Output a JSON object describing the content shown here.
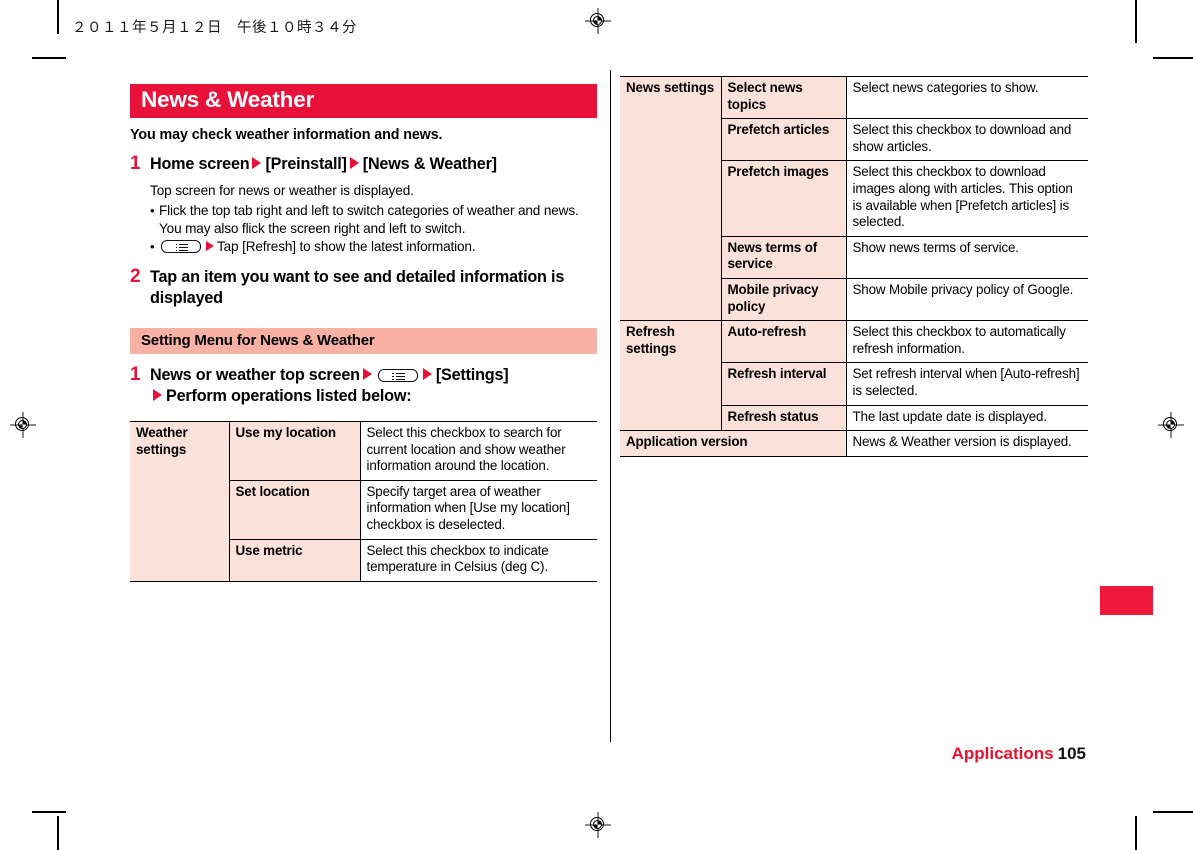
{
  "page": {
    "jp_date": "２０１１年５月１２日　午後１０時３４分",
    "footer_section": "Applications",
    "footer_page": "105",
    "accent_red": "#e8113a",
    "band_pink": "#f8b1a2",
    "cell_pink": "#fae2da"
  },
  "left": {
    "title": "News & Weather",
    "lead": "You may check weather information and news.",
    "step1": {
      "num": "1",
      "head_a": "Home screen",
      "head_b": "[Preinstall]",
      "head_c": "[News & Weather]",
      "para": "Top screen for news or weather is displayed.",
      "bullets": [
        {
          "dot": "•",
          "text": "Flick the top tab right and left to switch categories of weather and news. You may also flick the screen right and left to switch."
        }
      ],
      "bullet_key": {
        "dot": "•",
        "text": "Tap [Refresh] to show the latest information."
      }
    },
    "step2": {
      "num": "2",
      "head": "Tap an item you want to see and detailed information is displayed"
    },
    "sub_band": "Setting Menu for News & Weather",
    "step3": {
      "num": "1",
      "head_a": "News or weather top screen",
      "head_b": "[Settings]",
      "head_c": "Perform operations listed below:"
    },
    "table": {
      "groups": [
        {
          "name": "Weather settings",
          "rows": [
            {
              "key": "Use my location",
              "desc": "Select this checkbox to search for current location and show weather information around the location."
            },
            {
              "key": "Set location",
              "desc": "Specify target area of weather information when [Use my location] checkbox is deselected."
            },
            {
              "key": "Use metric",
              "desc": "Select this checkbox to indicate temperature in Celsius (deg C)."
            }
          ]
        }
      ]
    }
  },
  "right": {
    "table": {
      "groups": [
        {
          "name": "News settings",
          "rows": [
            {
              "key": "Select news topics",
              "desc": "Select news categories to show."
            },
            {
              "key": "Prefetch articles",
              "desc": "Select this checkbox to download and show articles."
            },
            {
              "key": "Prefetch images",
              "desc": "Select this checkbox to download images along with articles. This option is available when [Prefetch articles] is selected."
            },
            {
              "key": "News terms of service",
              "desc": "Show news terms of service."
            },
            {
              "key": "Mobile privacy policy",
              "desc": "Show Mobile privacy policy of Google."
            }
          ]
        },
        {
          "name": "Refresh settings",
          "rows": [
            {
              "key": "Auto-refresh",
              "desc": "Select this checkbox to automatically refresh information."
            },
            {
              "key": "Refresh interval",
              "desc": "Set refresh interval when [Auto-refresh] is selected."
            },
            {
              "key": "Refresh status",
              "desc": "The last update date is displayed."
            }
          ]
        }
      ],
      "full_row": {
        "key": "Application version",
        "desc": "News & Weather version is displayed."
      }
    }
  }
}
